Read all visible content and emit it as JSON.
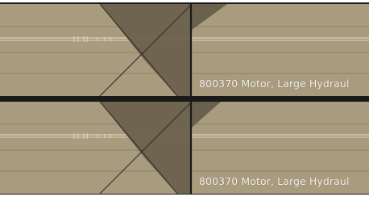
{
  "tracks": [
    {
      "clip_label": "800370 Motor, Large Hydraul"
    },
    {
      "clip_label": "800370 Motor, Large Hydraul"
    }
  ],
  "colors": {
    "track_fill": "#a89b7e",
    "transition_fill": "#7a6f58",
    "transition_dark": "#3e3b33",
    "separator": "#1a1a18",
    "waveform": "#eae3d2",
    "label": "#f4f1ea"
  }
}
